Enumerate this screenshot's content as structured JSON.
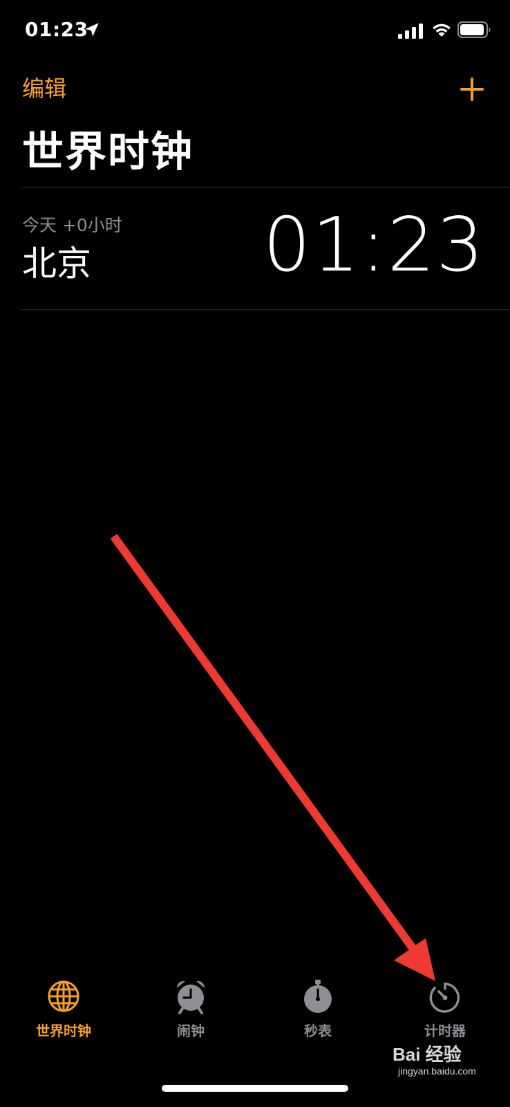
{
  "status_bar": {
    "time": "01:23",
    "icons": [
      "location-icon",
      "signal-icon",
      "wifi-icon",
      "battery-icon"
    ]
  },
  "header": {
    "edit_label": "编辑",
    "add_icon": "plus-icon",
    "title": "世界时钟"
  },
  "clocks": [
    {
      "offset": "今天 +0小时",
      "city": "北京",
      "time": "01:23"
    }
  ],
  "tabs": [
    {
      "label": "世界时钟",
      "icon": "globe-icon",
      "active": true
    },
    {
      "label": "闹钟",
      "icon": "alarm-clock-icon",
      "active": false
    },
    {
      "label": "秒表",
      "icon": "stopwatch-icon",
      "active": false
    },
    {
      "label": "计时器",
      "icon": "timer-icon",
      "active": false
    }
  ],
  "watermark": {
    "brand": "Bai 经验",
    "url": "jingyan.baidu.com"
  },
  "colors": {
    "accent": "#f7a12b",
    "inactive": "#8e8e93",
    "annotation": "#ee3b32",
    "background": "#000000"
  }
}
